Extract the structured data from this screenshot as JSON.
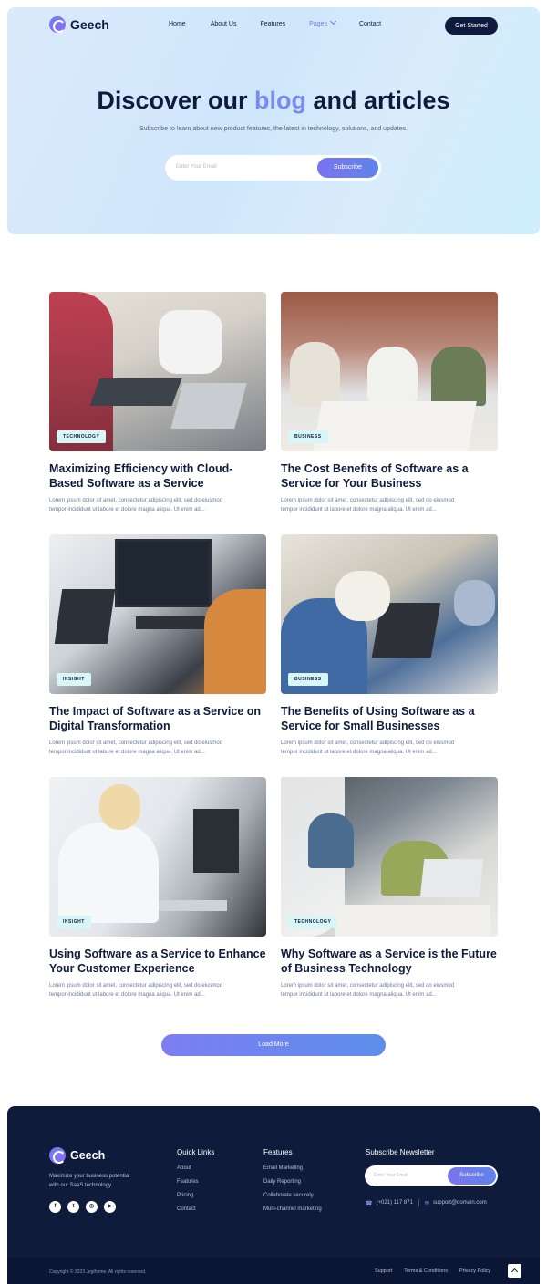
{
  "brand": {
    "name": "Geech"
  },
  "nav": {
    "items": [
      "Home",
      "About Us",
      "Features",
      "Pages",
      "Contact"
    ],
    "cta": "Get Started"
  },
  "hero": {
    "title_pre": "Discover our",
    "title_highlight": "blog",
    "title_post": "and articles",
    "subtitle": "Subscribe to learn about new product features, the latest in technology, solutions, and updates.",
    "email_placeholder": "Enter Your Email",
    "subscribe_label": "Subscribe"
  },
  "posts": [
    {
      "tag": "TECHNOLOGY",
      "title": "Maximizing Efficiency with Cloud-Based Software as a Service",
      "excerpt_1": "Lorem ipsum dolor sit amet, consectetur adipiscing elit, sed do eiusmod",
      "excerpt_2": "tempor incididunt ut labore et dolore magna aliqua. Ut enim ad..."
    },
    {
      "tag": "BUSINESS",
      "title": "The Cost Benefits of Software as a Service for Your Business",
      "excerpt_1": "Lorem ipsum dolor sit amet, consectetur adipiscing elit, sed do eiusmod",
      "excerpt_2": "tempor incididunt ut labore et dolore magna aliqua. Ut enim ad..."
    },
    {
      "tag": "INSIGHT",
      "title": "The Impact of Software as a Service on Digital Transformation",
      "excerpt_1": "Lorem ipsum dolor sit amet, consectetur adipiscing elit, sed do eiusmod",
      "excerpt_2": "tempor incididunt ut labore et dolore magna aliqua. Ut enim ad..."
    },
    {
      "tag": "BUSINESS",
      "title": "The Benefits of Using Software as a Service for Small Businesses",
      "excerpt_1": "Lorem ipsum dolor sit amet, consectetur adipiscing elit, sed do eiusmod",
      "excerpt_2": "tempor incididunt ut labore et dolore magna aliqua. Ut enim ad..."
    },
    {
      "tag": "INSIGHT",
      "title": "Using Software as a Service to Enhance Your Customer Experience",
      "excerpt_1": "Lorem ipsum dolor sit amet, consectetur adipiscing elit, sed do eiusmod",
      "excerpt_2": "tempor incididunt ut labore et dolore magna aliqua. Ut enim ad..."
    },
    {
      "tag": "TECHNOLOGY",
      "title": "Why Software as a Service is the Future of Business Technology",
      "excerpt_1": "Lorem ipsum dolor sit amet, consectetur adipiscing elit, sed do eiusmod",
      "excerpt_2": "tempor incididunt ut labore et dolore magna aliqua. Ut enim ad..."
    }
  ],
  "load_more": "Load More",
  "footer": {
    "about_1": "Maximize your business potential",
    "about_2": "with our SaaS technology",
    "socials": [
      "facebook-icon",
      "twitter-icon",
      "instagram-icon",
      "youtube-icon"
    ],
    "quick_links": {
      "heading": "Quick Links",
      "items": [
        "About",
        "Features",
        "Pricing",
        "Contact"
      ]
    },
    "features": {
      "heading": "Features",
      "items": [
        "Email Marketing",
        "Daily Reporting",
        "Collaborate securely",
        "Multi-channel marketing"
      ]
    },
    "newsletter": {
      "heading": "Subscribe Newsletter",
      "placeholder": "Enter Your Email",
      "button": "Subscribe"
    },
    "phone": "(+021) 117 871",
    "email": "support@domain.com",
    "copyright": "Copyright © 2023 Jegtheme. All rights reserved.",
    "bottom_links": [
      "Support",
      "Terms & Conditions",
      "Privacy Policy"
    ]
  }
}
